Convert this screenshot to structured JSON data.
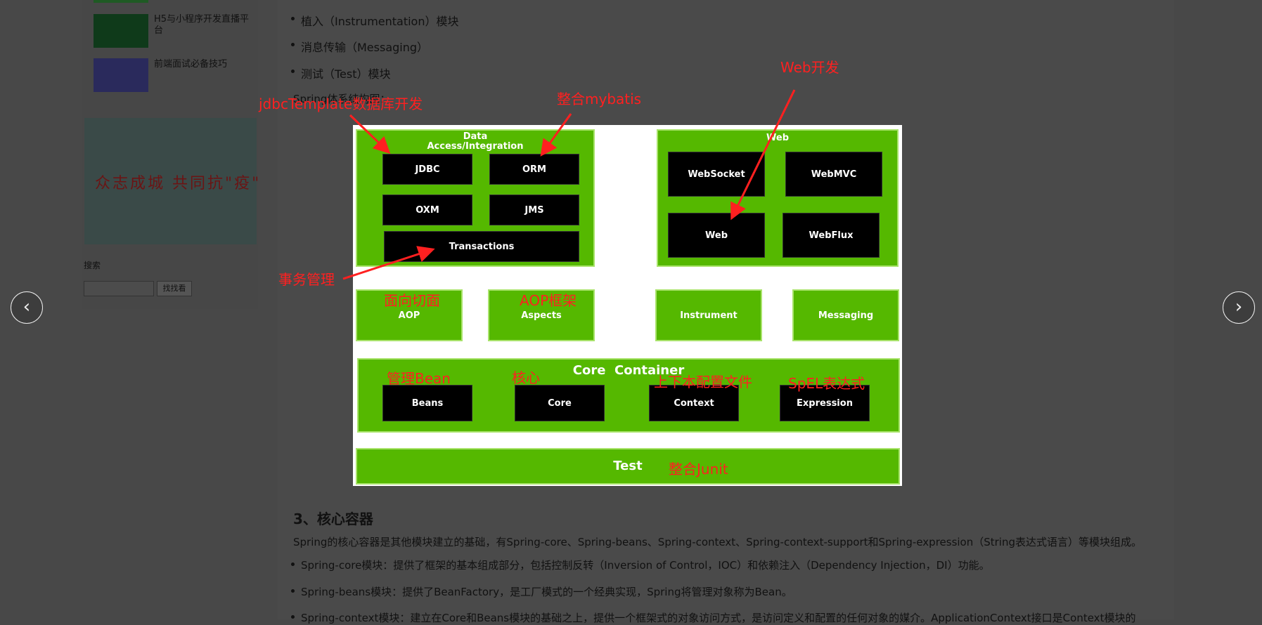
{
  "sidebar": {
    "items": [
      {
        "label": "H5与小程序开发直播平台"
      },
      {
        "label": "前端面试必备技巧"
      }
    ],
    "ad_text": "众志成城  共同抗\"疫\"",
    "search": {
      "label": "搜索",
      "placeholder": "",
      "button": "找找看"
    }
  },
  "article": {
    "list_top": [
      "植入（Instrumentation）模块",
      "消息传输（Messaging）",
      "测试（Test）模块"
    ],
    "partial_line": "Spring体系结构图：",
    "section_title": "3、核心容器",
    "section_para": "Spring的核心容器是其他模块建立的基础，有Spring-core、Spring-beans、Spring-context、Spring-context-support和Spring-expression（String表达式语言）等模块组成。",
    "list_bottom": [
      "Spring-core模块：提供了框架的基本组成部分，包括控制反转（Inversion of Control，IOC）和依赖注入（Dependency Injection，DI）功能。",
      "Spring-beans模块：提供了BeanFactory，是工厂模式的一个经典实现，Spring将管理对象称为Bean。",
      "Spring-context模块：建立在Core和Beans模块的基础之上，提供一个框架式的对象访问方式，是访问定义和配置的任何对象的媒介。ApplicationContext接口是Context模块的"
    ]
  },
  "diagram": {
    "data_title": "Data\nAccess/Integration",
    "data_modules": [
      "JDBC",
      "ORM",
      "OXM",
      "JMS",
      "Transactions"
    ],
    "web_title": "Web",
    "web_modules": [
      "WebSocket",
      "WebMVC",
      "Web",
      "WebFlux"
    ],
    "middle_modules": [
      "AOP",
      "Aspects",
      "Instrument",
      "Messaging"
    ],
    "core_title": "Core  Container",
    "core_modules": [
      "Beans",
      "Core",
      "Context",
      "Expression"
    ],
    "test_title": "Test",
    "colors": {
      "green": "#55b800",
      "black": "#000000",
      "annotation": "#ff2020"
    }
  },
  "annotations": {
    "jdbc": "jdbcTemplate数据库开发",
    "mybatis": "整合mybatis",
    "web": "Web开发",
    "tx": "事务管理",
    "aop": "面向切面",
    "aspects": "AOP框架",
    "bean": "管理Bean",
    "core": "核心",
    "context": "上下本配置文件",
    "spel": "SpEL表达式",
    "junit": "整合Junit"
  },
  "nav": {
    "prev_icon": "chevron-left-icon",
    "next_icon": "chevron-right-icon"
  }
}
